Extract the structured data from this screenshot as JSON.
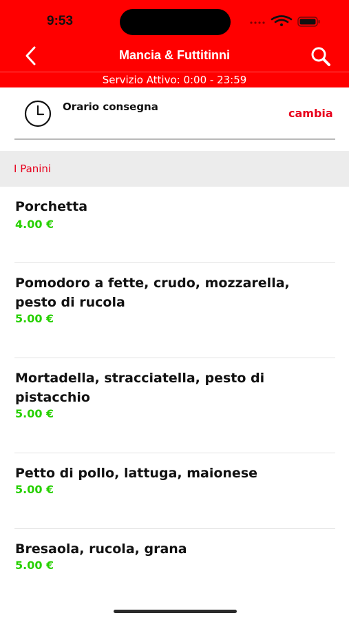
{
  "status_bar": {
    "time": "9:53"
  },
  "nav": {
    "title": "Mancia & Futtitinni",
    "back_icon": "chevron-left-icon",
    "search_icon": "search-icon"
  },
  "service": {
    "text": "Servizio Attivo: 0:00 - 23:59"
  },
  "delivery": {
    "label": "Orario consegna",
    "change_label": "cambia",
    "icon": "clock-icon"
  },
  "section": {
    "title": "I Panini"
  },
  "items": [
    {
      "name": "Porchetta",
      "price": "4.00 €"
    },
    {
      "name": "Pomodoro a fette, crudo, mozzarella, pesto di rucola",
      "price": "5.00 €"
    },
    {
      "name": "Mortadella, stracciatella, pesto di pistacchio",
      "price": "5.00 €"
    },
    {
      "name": "Petto di pollo, lattuga, maionese",
      "price": "5.00 €"
    },
    {
      "name": "Bresaola, rucola, grana",
      "price": "5.00 €"
    }
  ],
  "colors": {
    "brand": "#ff0000",
    "accent_text": "#e8001c",
    "price": "#27d000",
    "section_bg": "#ececec"
  }
}
